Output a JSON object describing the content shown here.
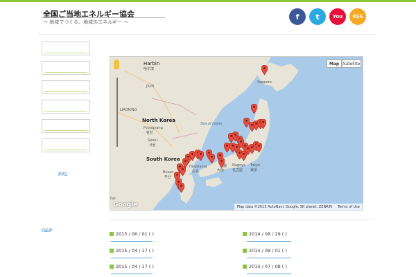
{
  "header": {
    "title": "全国ご当地エネルギー協会",
    "subtitle": "〜 地域でつくる、地域のエネルギー 〜"
  },
  "social": [
    {
      "name": "facebook",
      "glyph": "f",
      "color": "#3b5998"
    },
    {
      "name": "twitter",
      "glyph": "t",
      "color": "#2aa9e0"
    },
    {
      "name": "youtube",
      "glyph": "You",
      "color": "#e5103c"
    },
    {
      "name": "rss",
      "glyph": "RSS",
      "color": "#f7a824"
    }
  ],
  "sidebar": {
    "box_count": 6,
    "pps_label": "PPS",
    "isep_label": "ISEP"
  },
  "map": {
    "type_buttons": {
      "map": "Map",
      "satellite": "Satellite"
    },
    "labels": {
      "harbin": "Harbin",
      "harbin_cjk": "哈尔滨",
      "jilin": "JILIN",
      "liaoning": "LIAONING",
      "north_korea": "North Korea",
      "pyongyang": "Pyongyang",
      "pyongyang_kr": "평양",
      "seoul": "Seoul",
      "seoul_kr": "서울",
      "south_korea": "South Korea",
      "busan": "Busan",
      "busan_kr": "부산",
      "sea_of_japan": "Sea of Japan",
      "sapporo": "Sapporo",
      "hiroshima": "Hiroshima",
      "hiroshima_jp": "広島",
      "fukuoka_short": "Fu",
      "fukuoka_short_jp": "福",
      "nagoya": "Nagoya",
      "nagoya_jp": "名古屋",
      "tokyo": "Tokyo",
      "tokyo_jp": "東京",
      "osaka_short": "大阪",
      "kyoto_short": "京都",
      "shanghai_short": "hai"
    },
    "attribution": "Map data ©2015 AutoNavi, Google, SK planet, ZENRIN",
    "terms": "Terms of Use",
    "google": "Google"
  },
  "news": {
    "left": [
      "2015 / 06 / 01 ( )",
      "2015 / 04 / 17 ( )",
      "2015 / 04 / 17 ( )"
    ],
    "right": [
      "2014 / 08 / 29 ( )",
      "2014 / 08 / 01 ( )",
      "2014 / 07 / 08 ( )"
    ]
  }
}
